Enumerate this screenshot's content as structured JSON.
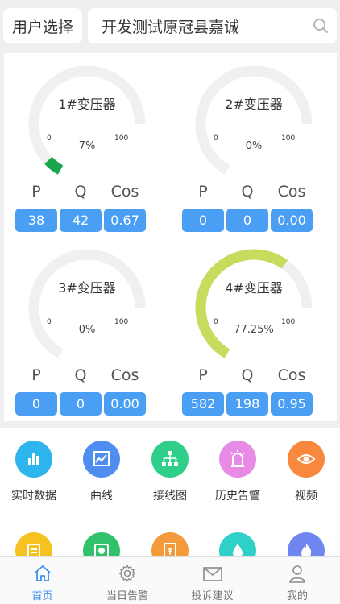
{
  "header": {
    "user_select_label": "用户选择",
    "search_value": "开发测试原冠县嘉诚"
  },
  "transformers": [
    {
      "name": "1#变压器",
      "percent_text": "7%",
      "percent": 7,
      "min": "0",
      "max": "100",
      "labels": [
        "P",
        "Q",
        "Cos"
      ],
      "values": [
        "38",
        "42",
        "0.67"
      ],
      "arc_color": "#1aa64a"
    },
    {
      "name": "2#变压器",
      "percent_text": "0%",
      "percent": 0,
      "min": "0",
      "max": "100",
      "labels": [
        "P",
        "Q",
        "Cos"
      ],
      "values": [
        "0",
        "0",
        "0.00"
      ],
      "arc_color": "#1aa64a"
    },
    {
      "name": "3#变压器",
      "percent_text": "0%",
      "percent": 0,
      "min": "0",
      "max": "100",
      "labels": [
        "P",
        "Q",
        "Cos"
      ],
      "values": [
        "0",
        "0",
        "0.00"
      ],
      "arc_color": "#1aa64a"
    },
    {
      "name": "4#变压器",
      "percent_text": "77.25%",
      "percent": 77.25,
      "min": "0",
      "max": "100",
      "labels": [
        "P",
        "Q",
        "Cos"
      ],
      "values": [
        "582",
        "198",
        "0.95"
      ],
      "arc_color": "#c5dc5c"
    }
  ],
  "features": [
    {
      "label": "实时数据",
      "icon": "bar-chart-icon",
      "color": "#2eb5ee"
    },
    {
      "label": "曲线",
      "icon": "trend-chart-icon",
      "color": "#4f8df0"
    },
    {
      "label": "接线图",
      "icon": "hierarchy-icon",
      "color": "#2fcf8a"
    },
    {
      "label": "历史告警",
      "icon": "alarm-light-icon",
      "color": "#e78be6"
    },
    {
      "label": "视频",
      "icon": "eye-icon",
      "color": "#f7883e"
    },
    {
      "label": "",
      "icon": "clipboard-icon",
      "color": "#f5c21f"
    },
    {
      "label": "",
      "icon": "document-icon",
      "color": "#31c16a"
    },
    {
      "label": "",
      "icon": "bill-icon",
      "color": "#f39a3a"
    },
    {
      "label": "",
      "icon": "water-drop-icon",
      "color": "#2fd0c8"
    },
    {
      "label": "",
      "icon": "flame-icon",
      "color": "#6f85f0"
    }
  ],
  "nav": [
    {
      "label": "首页",
      "icon": "home-icon",
      "active": true
    },
    {
      "label": "当日告警",
      "icon": "gear-icon",
      "active": false
    },
    {
      "label": "投诉建议",
      "icon": "mail-icon",
      "active": false
    },
    {
      "label": "我的",
      "icon": "person-icon",
      "active": false
    }
  ],
  "colors": {
    "accent": "#3d8ff0",
    "value_button": "#4a9ff5",
    "gauge_track": "#f0f0f0"
  }
}
